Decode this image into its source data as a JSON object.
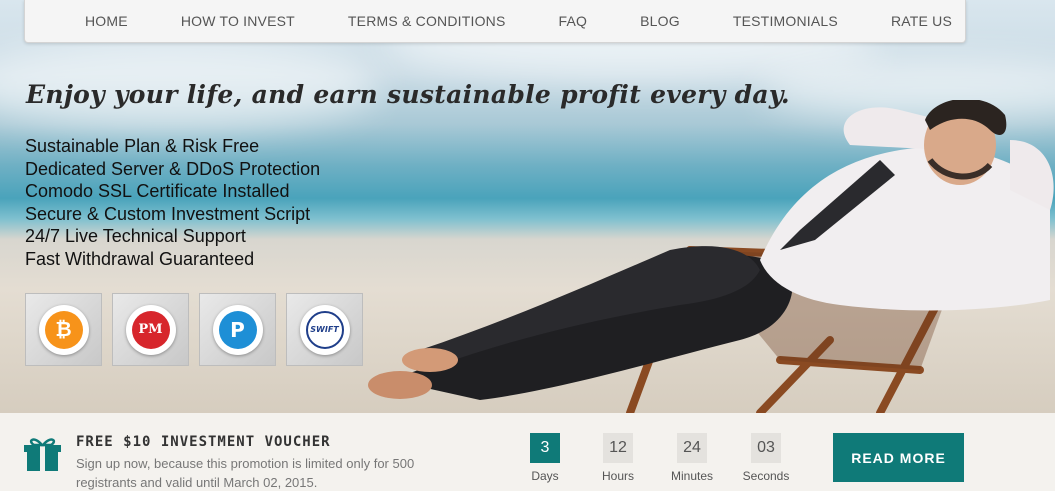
{
  "nav": {
    "items": [
      "HOME",
      "HOW TO INVEST",
      "TERMS & CONDITIONS",
      "FAQ",
      "BLOG",
      "TESTIMONIALS",
      "RATE US"
    ]
  },
  "hero": {
    "tagline": "Enjoy your life, and earn sustainable profit every day.",
    "features": [
      "Sustainable Plan & Risk Free",
      "Dedicated Server & DDoS Protection",
      "Comodo SSL Certificate Installed",
      "Secure & Custom Investment Script",
      "24/7 Live Technical Support",
      "Fast Withdrawal Guaranteed"
    ],
    "payment_icons": [
      {
        "name": "bitcoin-icon",
        "glyph": "B",
        "color": "#f7931a"
      },
      {
        "name": "perfect-money-icon",
        "glyph": "PM",
        "color": "#d7262c"
      },
      {
        "name": "payeer-icon",
        "glyph": "P",
        "color": "#1e8fd6"
      },
      {
        "name": "swift-icon",
        "glyph": "SWIFT",
        "color": "#1f3e8a"
      }
    ]
  },
  "promo": {
    "title": "FREE $10 INVESTMENT VOUCHER",
    "text": "Sign up now, because this promotion is limited only for 500 registrants and valid until March 02, 2015.",
    "countdown": [
      {
        "value": "3",
        "label": "Days"
      },
      {
        "value": "12",
        "label": "Hours"
      },
      {
        "value": "24",
        "label": "Minutes"
      },
      {
        "value": "03",
        "label": "Seconds"
      }
    ],
    "button_label": "READ MORE",
    "accent_color": "#0f7a78"
  }
}
